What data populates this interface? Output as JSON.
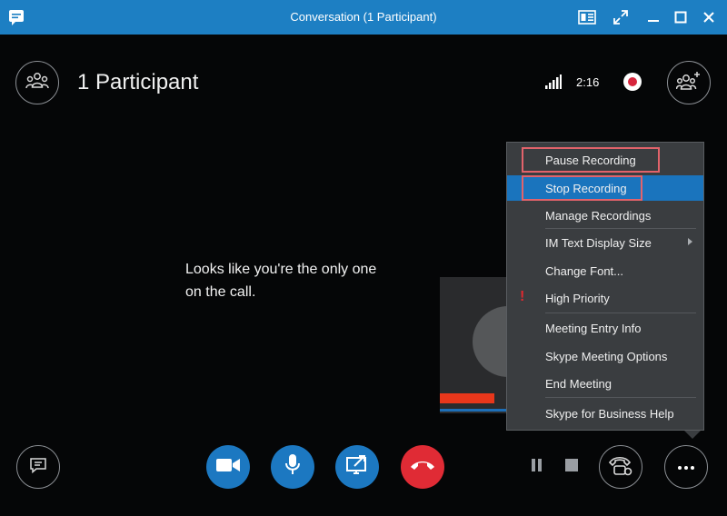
{
  "window": {
    "title": "Conversation (1 Participant)"
  },
  "header": {
    "participants_label": "1 Participant",
    "timer": "2:16"
  },
  "stage": {
    "message": "Looks like you're the only one on the call."
  },
  "menu": {
    "items": [
      {
        "label": "Pause Recording"
      },
      {
        "label": "Stop Recording"
      },
      {
        "label": "Manage Recordings"
      },
      {
        "label": "IM Text Display Size"
      },
      {
        "label": "Change Font..."
      },
      {
        "label": "High Priority"
      },
      {
        "label": "Meeting Entry Info"
      },
      {
        "label": "Skype Meeting Options"
      },
      {
        "label": "End Meeting"
      },
      {
        "label": "Skype for Business Help"
      }
    ],
    "priority_mark": "!"
  },
  "icons": {
    "app": "skype-for-business-icon",
    "show-participants": "participants-icon",
    "add-participant": "add-participant-icon",
    "signal": "signal-strength-icon",
    "recording": "recording-indicator-icon",
    "im": "chat-icon",
    "video": "video-camera-icon",
    "mic": "microphone-icon",
    "present": "present-icon",
    "hangup": "hang-up-icon",
    "call-controls": "call-controls-icon",
    "more": "more-options-icon"
  },
  "colors": {
    "titlebar": "#1d7fc3",
    "accent_blue": "#1c78c1",
    "hangup_red": "#e02b35",
    "menu_bg": "#3a3d40",
    "menu_selected": "#1a74bd",
    "highlight_outline": "#e2636b"
  }
}
